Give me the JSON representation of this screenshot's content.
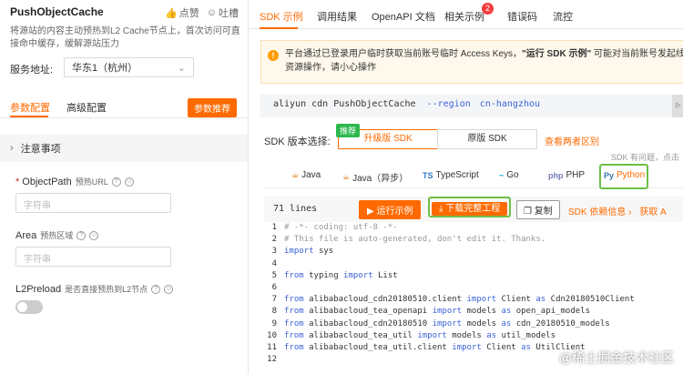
{
  "left": {
    "api_title": "PushObjectCache",
    "like_label": "点赞",
    "complain_label": "吐槽",
    "description": "将源站的内容主动预热到L2 Cache节点上，首次访问可直接命中缓存，缓解源站压力",
    "service_label": "服务地址:",
    "service_value": "华东1（杭州）",
    "tabs": [
      "参数配置",
      "高级配置"
    ],
    "recommend_button": "参数推荐",
    "notes_label": "注意事项",
    "fields": [
      {
        "name": "ObjectPath",
        "hint": "预热URL",
        "placeholder": "字符串",
        "required": true
      },
      {
        "name": "Area",
        "hint": "预热区域",
        "placeholder": "字符串",
        "required": false
      },
      {
        "name": "L2Preload",
        "hint": "是否直接预热到L2节点",
        "required": false
      }
    ]
  },
  "right": {
    "tabs": [
      "SDK 示例",
      "调用结果",
      "OpenAPI 文档",
      "相关示例",
      "错误码",
      "流控"
    ],
    "related_badge": "2",
    "notice_line1_prefix": "平台通过已登录用户临时获取当前账号临时 Access Keys，",
    "notice_line1_bold": "\"运行 SDK 示例\"",
    "notice_line1_suffix": " 可能对当前账号发起线",
    "notice_line2": "资源操作，请小心操作",
    "command": {
      "text": "aliyun cdn PushObjectCache",
      "flag": "--region",
      "value": "cn-hangzhou"
    },
    "sdk_version_label": "SDK 版本选择:",
    "recommend_tag": "推荐",
    "sdk_upgrade": "升级版 SDK",
    "sdk_original": "原版 SDK",
    "compare_link": "查看两者区别",
    "sdk_hint": "SDK 有问题，点击",
    "languages": [
      {
        "label": "Java",
        "icon": "java-icon"
      },
      {
        "label": "Java（异步）",
        "icon": "java-icon"
      },
      {
        "label": "TypeScript",
        "icon": "typescript-icon"
      },
      {
        "label": "Go",
        "icon": "go-icon"
      },
      {
        "label": "PHP",
        "icon": "php-icon"
      },
      {
        "label": "Python",
        "icon": "python-icon"
      }
    ],
    "selected_language": "Python",
    "lines_label": "71 lines",
    "run_button": "运行示例",
    "download_button": "下载完整工程",
    "copy_button": "复制",
    "deps_link": "SDK 依赖信息",
    "fetch_link": "获取 A",
    "code": [
      "# -*- coding: utf-8 -*-",
      "# This file is auto-generated, don't edit it. Thanks.",
      "import sys",
      "",
      "from typing import List",
      "",
      "from alibabacloud_cdn20180510.client import Client as Cdn20180510Client",
      "from alibabacloud_tea_openapi import models as open_api_models",
      "from alibabacloud_cdn20180510 import models as cdn_20180510_models",
      "from alibabacloud_tea_util import models as util_models",
      "from alibabacloud_tea_util.client import Client as UtilClient",
      ""
    ],
    "watermark": "@稀土掘金技术社区"
  },
  "colors": {
    "accent": "#ff6a00",
    "highlight_border": "#6bbf45",
    "keyword": "#3b63d8"
  }
}
